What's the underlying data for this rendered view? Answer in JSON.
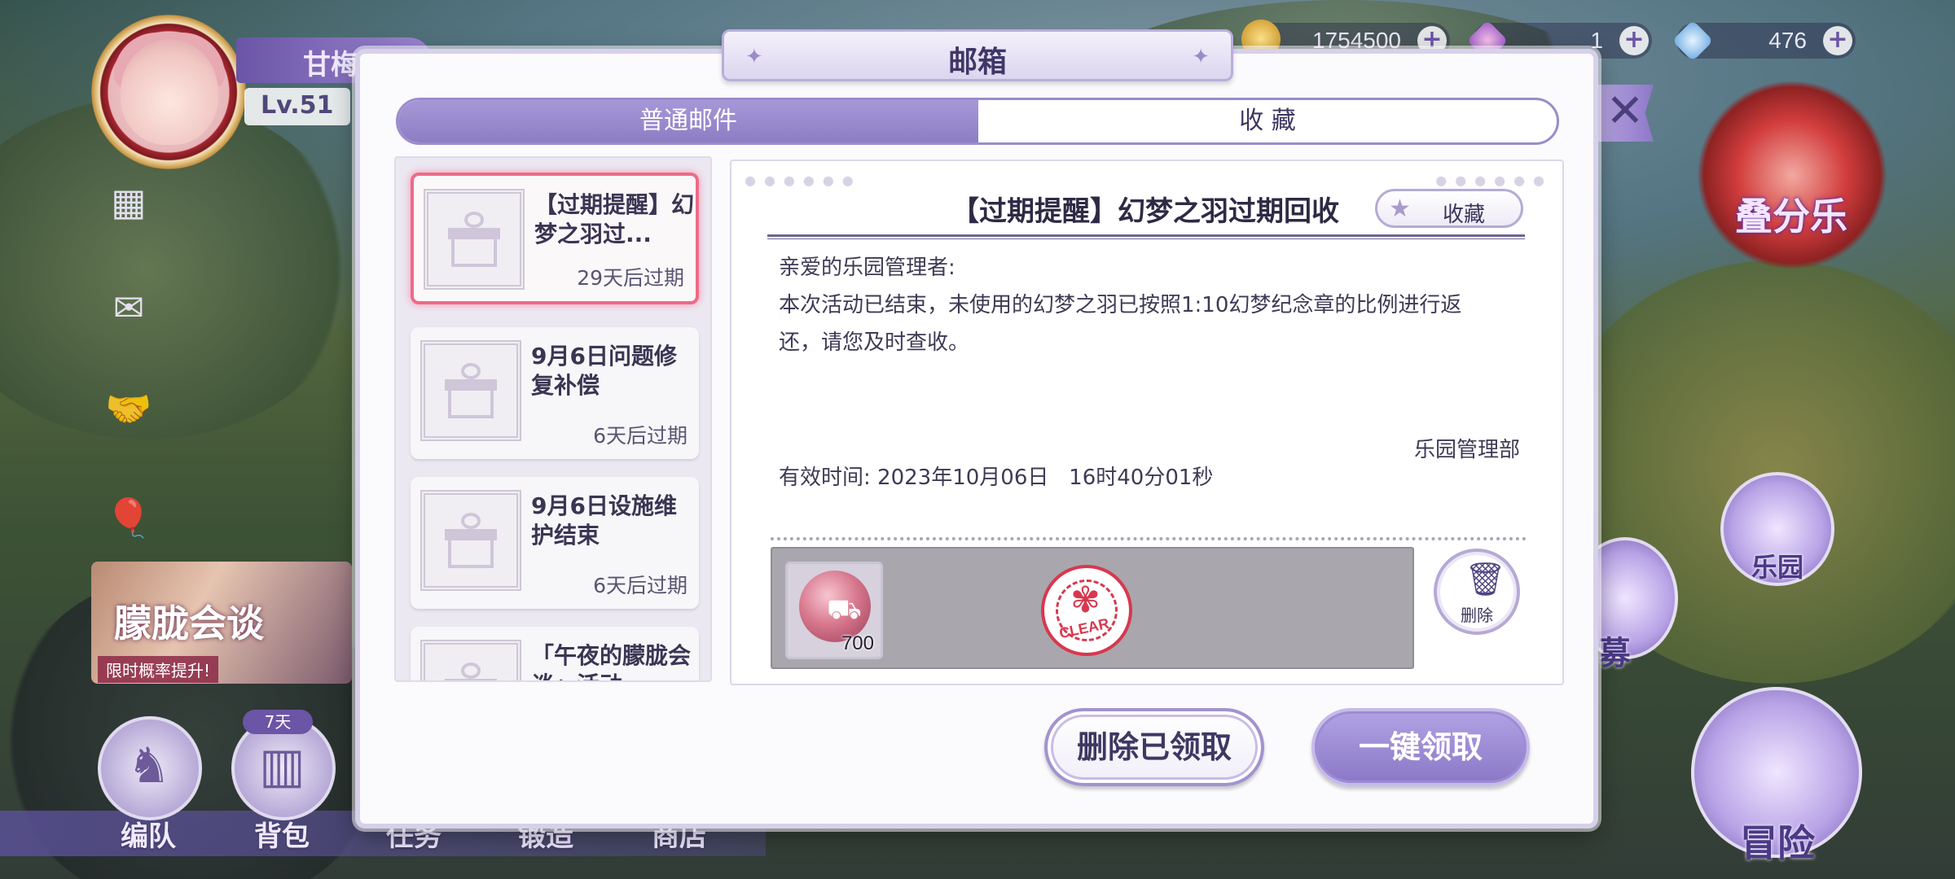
{
  "hud": {
    "player_name": "甘梅",
    "level": "Lv.51",
    "currencies": [
      {
        "icon": "gold-coin-icon",
        "value": "1754500"
      },
      {
        "icon": "pink-gem-icon",
        "value": "1"
      },
      {
        "icon": "blue-diamond-icon",
        "value": "476"
      }
    ],
    "plus": "+"
  },
  "background": {
    "banner_title": "朦胧会谈",
    "banner_sub": "限时概率提升!",
    "timer": "7天",
    "bottom_nav": [
      "编队",
      "背包",
      "任务",
      "锻造",
      "商店"
    ],
    "event_label": "叠分乐",
    "right_labels": [
      "乐园",
      "募",
      "冒险"
    ]
  },
  "mailbox": {
    "title": "邮箱",
    "tabs": [
      {
        "label": "普通邮件",
        "active": true
      },
      {
        "label": "收 藏",
        "active": false
      }
    ],
    "mails": [
      {
        "title": "【过期提醒】幻梦之羽过...",
        "expire": "29天后过期",
        "selected": true
      },
      {
        "title": "9月6日问题修复补偿",
        "expire": "6天后过期",
        "selected": false
      },
      {
        "title": "9月6日设施维护结束",
        "expire": "6天后过期",
        "selected": false
      },
      {
        "title": "「午夜的朦胧会谈」活动",
        "expire": "",
        "selected": false
      }
    ],
    "detail": {
      "title": "【过期提醒】幻梦之羽过期回收",
      "favorite_label": "收藏",
      "greeting": "亲爱的乐园管理者:",
      "body": "本次活动已结束，未使用的幻梦之羽已按照1:10幻梦纪念章的比例进行返还，请您及时查收。",
      "signature": "乐园管理部",
      "valid_label": "有效时间:",
      "valid_time": "2023年10月06日   16时40分01秒",
      "reward": {
        "icon": "souvenir-coin-icon",
        "quantity": "700"
      },
      "stamp_text": "CLEAR",
      "delete_label": "删除"
    },
    "buttons": {
      "delete_claimed": "删除已领取",
      "claim_all": "一键领取"
    }
  },
  "colors": {
    "accent": "#8c7dc4",
    "selected_border": "#f06a88",
    "stamp": "#d7384f"
  }
}
